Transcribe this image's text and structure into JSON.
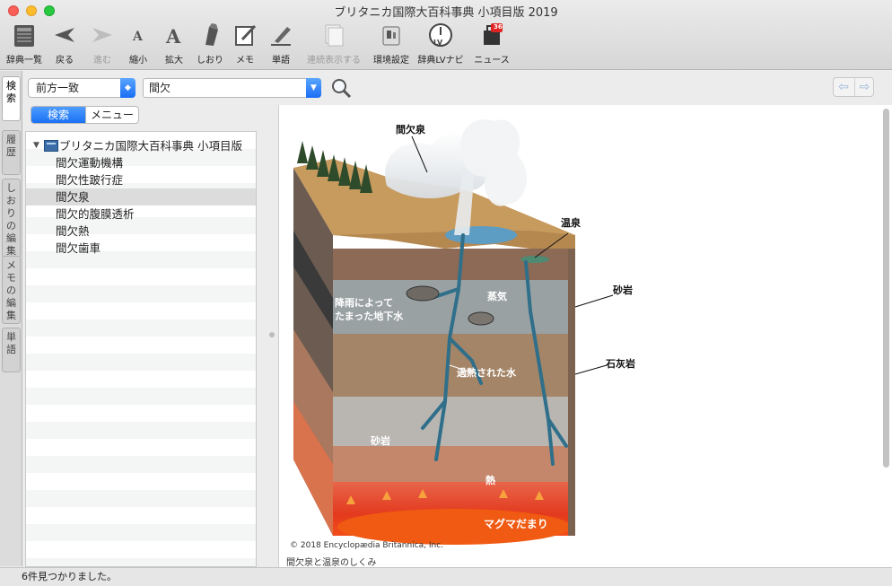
{
  "window": {
    "title": "ブリタニカ国際大百科事典 小項目版 2019"
  },
  "toolbar": {
    "items": [
      {
        "label": "辞典一覧",
        "icon": "dictionary-list-icon"
      },
      {
        "label": "戻る",
        "icon": "back-arrow-icon"
      },
      {
        "label": "進む",
        "icon": "forward-arrow-icon"
      },
      {
        "label": "縮小",
        "icon": "font-shrink-icon"
      },
      {
        "label": "拡大",
        "icon": "font-enlarge-icon"
      },
      {
        "label": "しおり",
        "icon": "bookmark-icon"
      },
      {
        "label": "メモ",
        "icon": "memo-icon"
      },
      {
        "label": "単語",
        "icon": "word-icon"
      },
      {
        "label": "連続表示する",
        "icon": "continuous-display-icon"
      },
      {
        "label": "環境設定",
        "icon": "preferences-icon"
      },
      {
        "label": "辞典LVナビ",
        "icon": "lv-navi-icon"
      },
      {
        "label": "ニュース",
        "icon": "news-icon",
        "badge": "36"
      }
    ]
  },
  "side_tabs": [
    "検索",
    "履歴",
    "しおりの編集",
    "メモの編集",
    "単語"
  ],
  "search": {
    "mode": "前方一致",
    "term": "間欠"
  },
  "segmented": {
    "search_label": "検索",
    "menu_label": "メニュー"
  },
  "results": {
    "root": "ブリタニカ国際大百科事典 小項目版",
    "items": [
      "間欠運動機構",
      "間欠性跛行症",
      "間欠泉",
      "間欠的腹膜透析",
      "間欠熱",
      "間欠歯車"
    ],
    "selected_index": 2
  },
  "figure": {
    "labels": {
      "geyser": "間欠泉",
      "hot_spring": "温泉",
      "sandstone_upper": "砂岩",
      "limestone": "石灰岩",
      "groundwater_line1": "降雨によって",
      "groundwater_line2": "たまった地下水",
      "steam": "蒸気",
      "superheated_water": "過熱された水",
      "sandstone_lower": "砂岩",
      "heat": "熱",
      "magma": "マグマだまり"
    },
    "copyright": "© 2018 Encyclopædia Britannica, Inc.",
    "caption": "間欠泉と温泉のしくみ"
  },
  "status": {
    "text": "6件見つかりました。"
  }
}
